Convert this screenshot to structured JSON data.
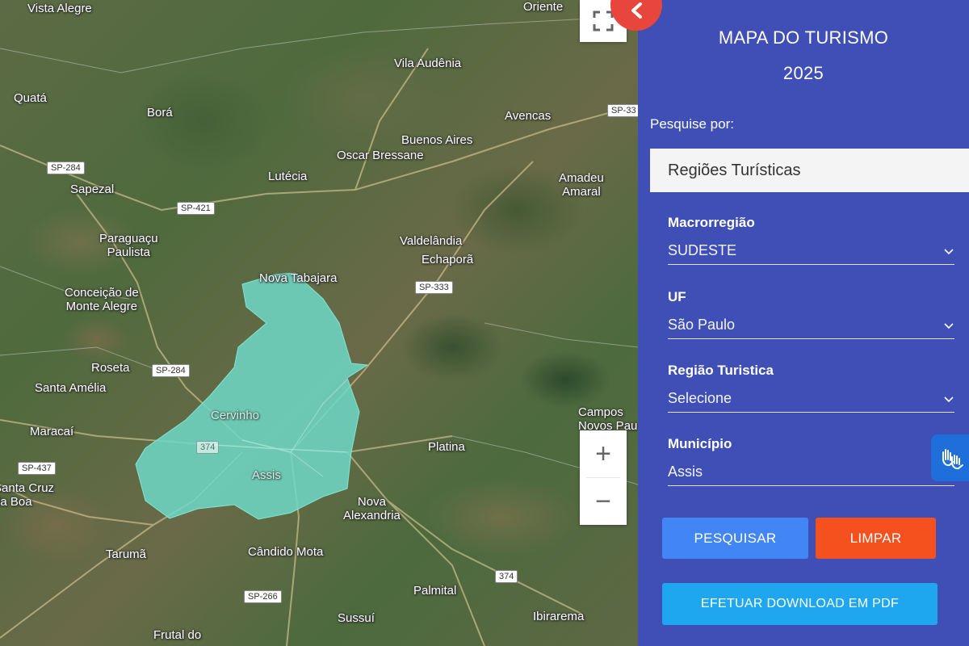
{
  "sidebar": {
    "title_line1": "MAPA DO TURISMO",
    "title_line2": "2025",
    "search_by_label": "Pesquise por:",
    "search_by_value": "Regiões Turísticas",
    "fields": {
      "macro": {
        "label": "Macrorregião",
        "value": "SUDESTE"
      },
      "uf": {
        "label": "UF",
        "value": "São Paulo"
      },
      "region": {
        "label": "Região Turistica",
        "value": "Selecione"
      },
      "municipality": {
        "label": "Município",
        "value": "Assis"
      }
    },
    "buttons": {
      "search": "PESQUISAR",
      "clear": "LIMPAR",
      "pdf": "EFETUAR DOWNLOAD EM PDF"
    }
  },
  "map": {
    "zoom_in": "+",
    "zoom_out": "−",
    "places": {
      "vista_alegre": "Vista Alegre",
      "oriente": "Oriente",
      "vila_audenia": "Vila Audênia",
      "quata": "Quatá",
      "bora": "Borá",
      "avencas": "Avencas",
      "buenos_aires": "Buenos Aires",
      "oscar_bressane": "Oscar Bressane",
      "lutecia": "Lutécia",
      "amadeu_amaral": "Amadeu\nAmaral",
      "sapezal": "Sapezal",
      "paraguacu": "Paraguaçu\nPaulista",
      "valdelandia": "Valdelândia",
      "echapora": "Echaporã",
      "nova_tabajara": "Nova Tabajara",
      "conceicao": "Conceição de\nMonte Alegre",
      "roseta": "Roseta",
      "santa_amelia": "Santa Amélia",
      "cervinho": "Cervinho",
      "maracai": "Maracaí",
      "assis": "Assis",
      "platina": "Platina",
      "campos_novos": "Campos\nNovos Pau",
      "santa_cruz": "Santa Cruz\nda Boa",
      "nova_alexandria": "Nova\nAlexandria",
      "taruma": "Tarumã",
      "candido_mota": "Cândido Mota",
      "palmital": "Palmital",
      "sussui": "Sussuí",
      "ibirarema": "Ibirarema",
      "frutal": "Frutal do"
    },
    "shields": {
      "sp284a": "SP-284",
      "sp421": "SP-421",
      "sp333a": "SP-333",
      "sp333b": "SP-33",
      "sp284b": "SP-284",
      "r374a": "374",
      "sp437": "SP-437",
      "r374b": "374",
      "sp266": "SP-266"
    },
    "highlight_color": "#6fd8c7"
  }
}
